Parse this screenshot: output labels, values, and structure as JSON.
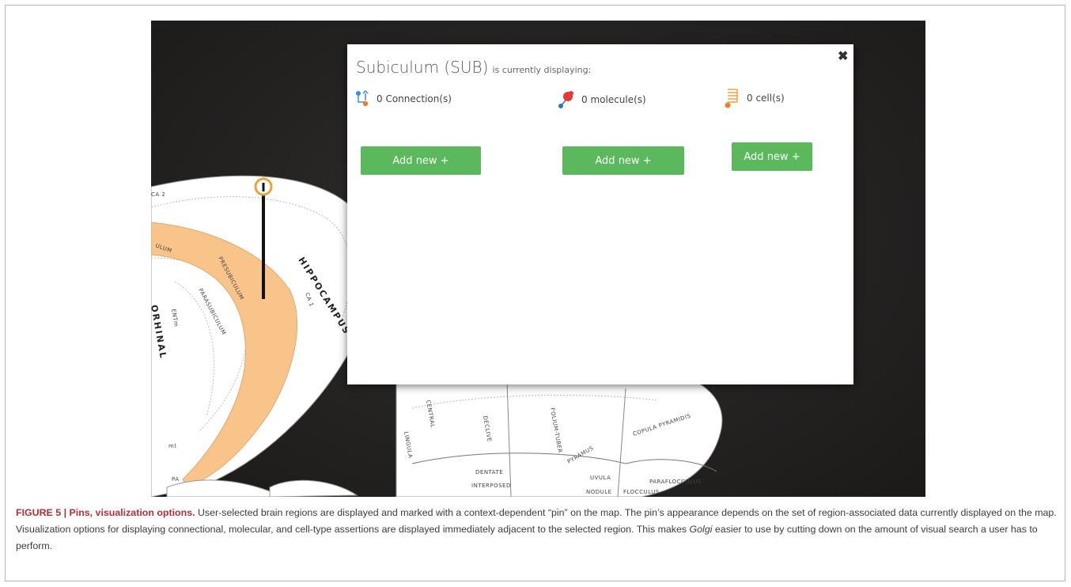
{
  "modal": {
    "region_name": "Subiculum (SUB)",
    "title_suffix": "is currently displaying:",
    "close_glyph": "✖",
    "columns": [
      {
        "icon": "connection-icon",
        "label": "0 Connection(s)",
        "button": "Add new +"
      },
      {
        "icon": "molecule-icon",
        "label": "0 molecule(s)",
        "button": "Add new +"
      },
      {
        "icon": "cell-icon",
        "label": "0 cell(s)",
        "button": "Add new +"
      }
    ],
    "button_color": "#5cb85c"
  },
  "map": {
    "highlight_color": "#f8c48a",
    "pin_color": "#e8a33a",
    "labels": {
      "ca2": "CA 2",
      "ca1": "CA 1",
      "hippocampus": "HIPPOCAMPUS",
      "ulum": "ULUM",
      "presubiculum": "PRESUBICULUM",
      "parasubiculum": "PARASUBICULUM",
      "entm": "ENTm",
      "orhinal": "ORHINAL",
      "ml": "ml",
      "pa": "PA",
      "central": "CENTRAL",
      "lingula": "LINGULA",
      "declive": "DECLIVE",
      "folium_tuber": "FOLIUM-TUBER",
      "pyramus": "PYRAMUS",
      "copula_pyramidis": "COPULA PYRAMIDIS",
      "uvula": "UVULA",
      "paraflocculus": "PARAFLOCCULUS",
      "dentate": "DENTATE",
      "interposed": "INTERPOSED",
      "nodule": "NODULE",
      "flocculus": "FLOCCULUS"
    }
  },
  "caption": {
    "figure_label": "FIGURE 5 | Pins, visualization options.",
    "text_1": " User-selected brain regions are displayed and marked with a context-dependent “pin” on the map. The pin’s appearance depends on the set of region-associated data currently displayed on the map. Visualization options for displaying connectional, molecular, and cell-type assertions are displayed immediately adjacent to the selected region. This makes ",
    "italic": "Golgi",
    "text_2": " easier to use by cutting down on the amount of visual search a user has to perform."
  }
}
